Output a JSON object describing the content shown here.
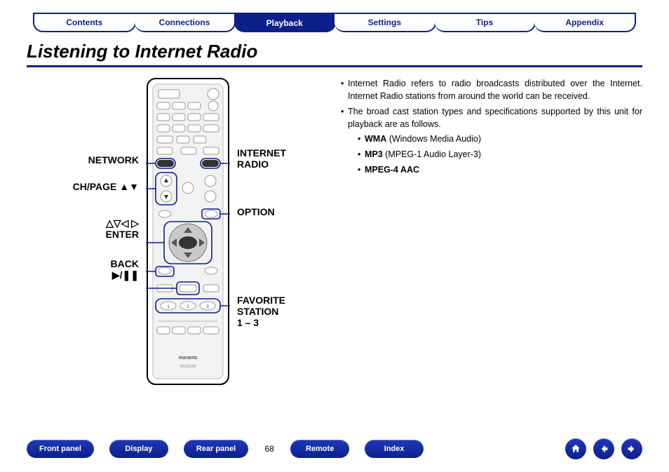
{
  "tabs": [
    "Contents",
    "Connections",
    "Playback",
    "Settings",
    "Tips",
    "Appendix"
  ],
  "active_tab_index": 2,
  "title": "Listening to Internet Radio",
  "remote_labels": {
    "network": "NETWORK",
    "chpage": "CH/PAGE",
    "chpage_arrows": "▲▼",
    "enter_arrows": "△▽◁ ▷",
    "enter": "ENTER",
    "back": "BACK",
    "playpause": "▶/❚❚",
    "internet_radio": "INTERNET\nRADIO",
    "option": "OPTION",
    "favorite": "FAVORITE\nSTATION\n1 – 3"
  },
  "body": {
    "b1": "Internet Radio refers to radio broadcasts distributed over the Internet. Internet Radio stations from around the world can be received.",
    "b2": "The broad cast station types and specifications supported by this unit for playback are as follows.",
    "f1a": "WMA",
    "f1b": " (Windows Media Audio)",
    "f2a": "MP3",
    "f2b": " (MPEG-1 Audio Layer-3)",
    "f3a": "MPEG-4 AAC"
  },
  "footer": {
    "links_left": [
      "Front panel",
      "Display",
      "Rear panel"
    ],
    "page": "68",
    "links_right": [
      "Remote",
      "Index"
    ]
  },
  "remote_model": "RC021SR",
  "remote_brand": "marantz"
}
